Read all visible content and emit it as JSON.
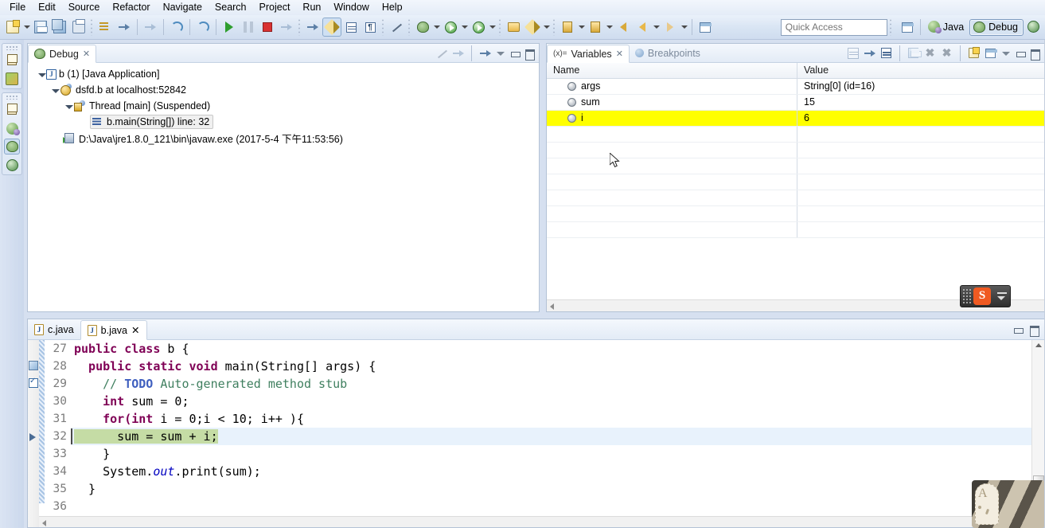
{
  "menu": {
    "items": [
      "File",
      "Edit",
      "Source",
      "Refactor",
      "Navigate",
      "Search",
      "Project",
      "Run",
      "Window",
      "Help"
    ]
  },
  "toolbar": {
    "icons": [
      {
        "name": "new-wizard-icon",
        "glyph": "doc"
      },
      {
        "name": "save-icon",
        "glyph": "save"
      },
      {
        "name": "save-all-icon",
        "glyph": "saveall"
      },
      {
        "name": "print-icon",
        "glyph": "print"
      },
      {
        "name": "build-all-icon",
        "glyph": "lines"
      },
      {
        "name": "toggle-breakpoint-icon",
        "glyph": "jumparrow"
      },
      {
        "name": "skip-all-breakpoints-icon",
        "glyph": "curvearrow"
      },
      {
        "name": "resume-icon",
        "glyph": "green-run"
      },
      {
        "name": "suspend-icon",
        "glyph": "pause"
      },
      {
        "name": "terminate-icon",
        "glyph": "stop"
      },
      {
        "name": "disconnect-icon",
        "glyph": "jumparrow"
      },
      {
        "name": "step-into-icon",
        "glyph": "bug"
      },
      {
        "name": "marker-icon",
        "glyph": "pencil"
      },
      {
        "name": "show-table-icon",
        "glyph": "table-ic"
      },
      {
        "name": "paragraph-icon",
        "glyph": "pilcrow"
      },
      {
        "name": "skip-breakpoints-icon",
        "glyph": "nopen"
      },
      {
        "name": "debug-icon",
        "glyph": "bug"
      },
      {
        "name": "run-icon",
        "glyph": "circle-green"
      },
      {
        "name": "external-tools-icon",
        "glyph": "circle-green"
      },
      {
        "name": "open-type-icon",
        "glyph": "folder"
      },
      {
        "name": "new-java-class-icon",
        "glyph": "pencil"
      },
      {
        "name": "previous-annotation-icon",
        "glyph": "updown"
      },
      {
        "name": "next-annotation-icon",
        "glyph": "updown"
      },
      {
        "name": "back-icon",
        "glyph": "arrow-back"
      },
      {
        "name": "backward-icon",
        "glyph": "arrow-l"
      },
      {
        "name": "forward-icon",
        "glyph": "arrow-r"
      },
      {
        "name": "new-editor-icon",
        "glyph": "persp-new"
      }
    ],
    "quick_access_placeholder": "Quick Access"
  },
  "perspectives": {
    "open_perspective_label": "",
    "items": [
      {
        "label": "Java",
        "active": false,
        "icon": "java-perspective-icon"
      },
      {
        "label": "Debug",
        "active": true,
        "icon": "debug-perspective-icon"
      },
      {
        "label": "",
        "active": false,
        "icon": "globe-perspective-icon"
      }
    ]
  },
  "debug_view": {
    "tab_label": "Debug",
    "tab_icon": "bug-icon",
    "tree": [
      {
        "indent": 0,
        "twisty": "open",
        "icon": "launch-config-icon",
        "label": "b (1) [Java Application]"
      },
      {
        "indent": 1,
        "twisty": "open",
        "icon": "debug-target-icon",
        "label": "dsfd.b at localhost:52842"
      },
      {
        "indent": 2,
        "twisty": "open",
        "icon": "thread-icon",
        "label": "Thread [main] (Suspended)"
      },
      {
        "indent": 3,
        "twisty": "none",
        "icon": "stack-frame-icon",
        "label": "b.main(String[]) line: 32",
        "selected": true
      },
      {
        "indent": 2,
        "twisty": "none",
        "icon": "process-icon",
        "label": "D:\\Java\\jre1.8.0_121\\bin\\javaw.exe (2017-5-4 下午11:53:56)"
      }
    ],
    "toolbar_icons": [
      "remove-all-terminated-icon",
      "relaunch-icon",
      "step-return-icon"
    ]
  },
  "variables_view": {
    "tabs": [
      {
        "label": "Variables",
        "active": true,
        "icon": "variables-icon",
        "closable": true
      },
      {
        "label": "Breakpoints",
        "active": false,
        "icon": "breakpoints-icon",
        "closable": false
      }
    ],
    "columns": [
      "Name",
      "Value"
    ],
    "rows": [
      {
        "name": "args",
        "value": "String[0]  (id=16)",
        "highlighted": false
      },
      {
        "name": "sum",
        "value": "15",
        "highlighted": false
      },
      {
        "name": "i",
        "value": "6",
        "highlighted": true
      }
    ],
    "empty_row_count": 7,
    "toolbar_icons": [
      "show-logical-structure-icon",
      "collapse-expand-icon",
      "collapse-all-icon",
      "lock-icon",
      "remove-selected-icon",
      "remove-all-icon",
      "new-detail-pane-icon",
      "detail-pane-layout-icon"
    ],
    "highlight_color": "#ffff00"
  },
  "editor": {
    "tabs": [
      {
        "label": "c.java",
        "active": false,
        "closable": false
      },
      {
        "label": "b.java",
        "active": true,
        "closable": true
      }
    ],
    "current_line": 32,
    "lines": [
      {
        "num": "27",
        "tokens": [
          {
            "t": "kw",
            "s": "public class "
          },
          {
            "t": "pl",
            "s": "b {"
          }
        ],
        "indent": 0
      },
      {
        "num": "28",
        "tokens": [
          {
            "t": "kw",
            "s": "  public static void "
          },
          {
            "t": "pl",
            "s": "main(String[] args) {"
          }
        ],
        "indent": 0,
        "folding": true,
        "marker": "dbg-mark"
      },
      {
        "num": "29",
        "tokens": [
          {
            "t": "cm",
            "s": "    // "
          },
          {
            "t": "todo",
            "s": "TODO"
          },
          {
            "t": "cm",
            "s": " Auto-generated method stub"
          }
        ],
        "indent": 0,
        "marker": "todo-mark"
      },
      {
        "num": "30",
        "tokens": [
          {
            "t": "kw",
            "s": "    int "
          },
          {
            "t": "pl",
            "s": "sum = 0;"
          }
        ],
        "indent": 0
      },
      {
        "num": "31",
        "tokens": [
          {
            "t": "kw",
            "s": "    for("
          },
          {
            "t": "kw",
            "s": "int "
          },
          {
            "t": "pl",
            "s": "i = 0;i < 10; i++ ){"
          }
        ],
        "indent": 0
      },
      {
        "num": "32",
        "tokens": [
          {
            "t": "hl",
            "s": "      sum = sum + i;"
          }
        ],
        "indent": 0,
        "current": true,
        "marker": "ip-arrow"
      },
      {
        "num": "33",
        "tokens": [
          {
            "t": "pl",
            "s": "    }"
          }
        ],
        "indent": 0
      },
      {
        "num": "34",
        "tokens": [
          {
            "t": "pl",
            "s": "    System."
          },
          {
            "t": "fld",
            "s": "out"
          },
          {
            "t": "pl",
            "s": ".print(sum);"
          }
        ],
        "indent": 0
      },
      {
        "num": "35",
        "tokens": [
          {
            "t": "pl",
            "s": "  }"
          }
        ],
        "indent": 0
      },
      {
        "num": "36",
        "tokens": [
          {
            "t": "pl",
            "s": ""
          }
        ],
        "indent": 0
      }
    ]
  },
  "ime": {
    "logo_text": "S",
    "name": "sogou-ime-toolbar"
  },
  "fastview": {
    "groups": [
      {
        "icons": [
          "restore-icon",
          "package-explorer-icon"
        ]
      },
      {
        "icons": [
          "restore-icon",
          "java-perspective-icon",
          "debug-perspective-icon",
          "globe-perspective-icon"
        ]
      }
    ]
  },
  "colors": {
    "highlight_yellow": "#ffff00",
    "exec_line_green": "#c5dca5",
    "current_row_blue": "#e8f2fc",
    "keyword": "#7f0055",
    "comment": "#3f7f5f",
    "todo": "#3f5fbf",
    "field": "#0000c0"
  }
}
